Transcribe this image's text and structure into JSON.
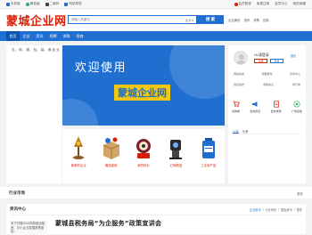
{
  "topbar": {
    "left": [
      {
        "label": "手机版",
        "icon": "phone-icon",
        "color": "#1f6fd1"
      },
      {
        "label": "微信版",
        "icon": "wechat-icon",
        "color": "#2aae67"
      },
      {
        "label": "二维码",
        "icon": "qrcode-icon",
        "color": "#444444"
      },
      {
        "label": "网站导航",
        "icon": "grid-icon",
        "color": "#1f6fd1"
      }
    ],
    "right": [
      {
        "label": "会员登录"
      },
      {
        "label": "免费注册"
      },
      {
        "label": "会员中心"
      },
      {
        "label": "我的收藏"
      }
    ]
  },
  "header": {
    "logo": "蒙城企业网",
    "search_placeholder": "请输入关键词",
    "search_scope": "企业 ▾",
    "search_button": "搜 索",
    "links": [
      "企业黄页",
      "资讯",
      "求购",
      "招标"
    ]
  },
  "nav": [
    "首页",
    "企业",
    "资讯",
    "招聘",
    "求购",
    "招商"
  ],
  "categories": [
    {
      "label": "五、 科、 报、 包、 装、 食 品 业"
    }
  ],
  "banner": {
    "line1": "欢迎使用",
    "line2": "蒙城企业网"
  },
  "products": [
    {
      "label": "新奇的企业",
      "icon": "lamp-icon"
    },
    {
      "label": "爆品促销",
      "icon": "box-icon"
    },
    {
      "label": "我的特价",
      "icon": "gift-icon"
    },
    {
      "label": "灯饰精选",
      "icon": "robot-icon"
    },
    {
      "label": "工业用产品",
      "icon": "container-icon"
    }
  ],
  "user": {
    "greeting": "Hi,请登录",
    "register": "注册",
    "login": "登录",
    "logout": "退出",
    "links_row1": [
      "网站动态",
      "我要发布",
      "商务中心"
    ],
    "links_row2": [
      "供应发布",
      "求购信息",
      "排行榜"
    ]
  },
  "quick": [
    {
      "label": "采购单",
      "icon": "cart-icon",
      "color": "#d81e06"
    },
    {
      "label": "发布供应",
      "icon": "megaphone-icon",
      "color": "#1f6fd1"
    },
    {
      "label": "发布求购",
      "icon": "doc-icon",
      "color": "#d81e06"
    },
    {
      "label": "广告投放",
      "icon": "target-icon",
      "color": "#2aae67"
    }
  ],
  "sidebar_tabs": [
    "公告",
    "头条"
  ],
  "market": {
    "title": "行业市场",
    "more": "更多"
  },
  "info": {
    "title": "资讯中心",
    "filter_tabs": [
      "企业资讯",
      "行业资讯",
      "展会资讯",
      "更多"
    ],
    "side_text": "关于开展2024年制造业融资、中小企业发展政策宣讲...",
    "headline": "蒙城县税务局“为企服务”政策宣讲会"
  },
  "colors": {
    "primary": "#1f6fd1",
    "brand": "#d81e06",
    "accent": "#f2c811"
  }
}
